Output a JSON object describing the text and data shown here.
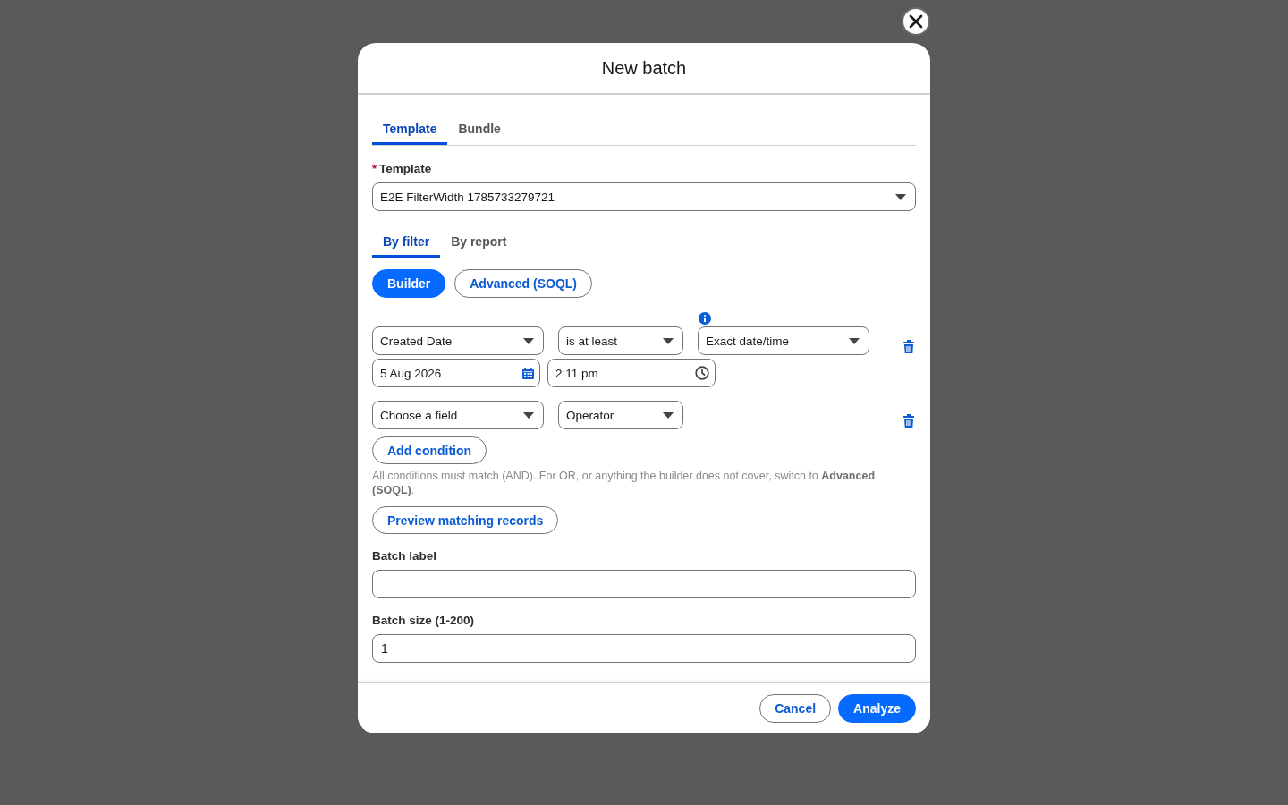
{
  "dialog": {
    "title": "New batch"
  },
  "tabs": [
    {
      "label": "Template",
      "selected": true
    },
    {
      "label": "Bundle",
      "selected": false
    }
  ],
  "template_field": {
    "label": "Template",
    "required_mark": "*",
    "value": "E2E FilterWidth 1785733279721"
  },
  "source_tabs": [
    {
      "label": "By filter",
      "selected": true
    },
    {
      "label": "By report",
      "selected": false
    }
  ],
  "mode_buttons": [
    {
      "label": "Builder",
      "selected": true
    },
    {
      "label": "Advanced (SOQL)",
      "selected": false
    }
  ],
  "conditions": [
    {
      "field": "Created Date",
      "operator": "is at least",
      "value_type": "Exact date/time",
      "date": "5 Aug 2026",
      "time": "2:11 pm"
    },
    {
      "field": "Choose a field",
      "operator": "Operator"
    }
  ],
  "add_condition_button": "Add condition",
  "help_text": "All conditions must match (AND). For OR, or anything the builder does not cover, switch to **Advanced (SOQL)**.",
  "preview_button": "Preview matching records",
  "fields": [
    {
      "label": "Batch label"
    },
    {
      "label": "Batch size (1-200)",
      "value": "1"
    }
  ],
  "footer_buttons": [
    {
      "label": "Cancel",
      "kind": "secondary"
    },
    {
      "label": "Analyze",
      "kind": "primary"
    }
  ]
}
